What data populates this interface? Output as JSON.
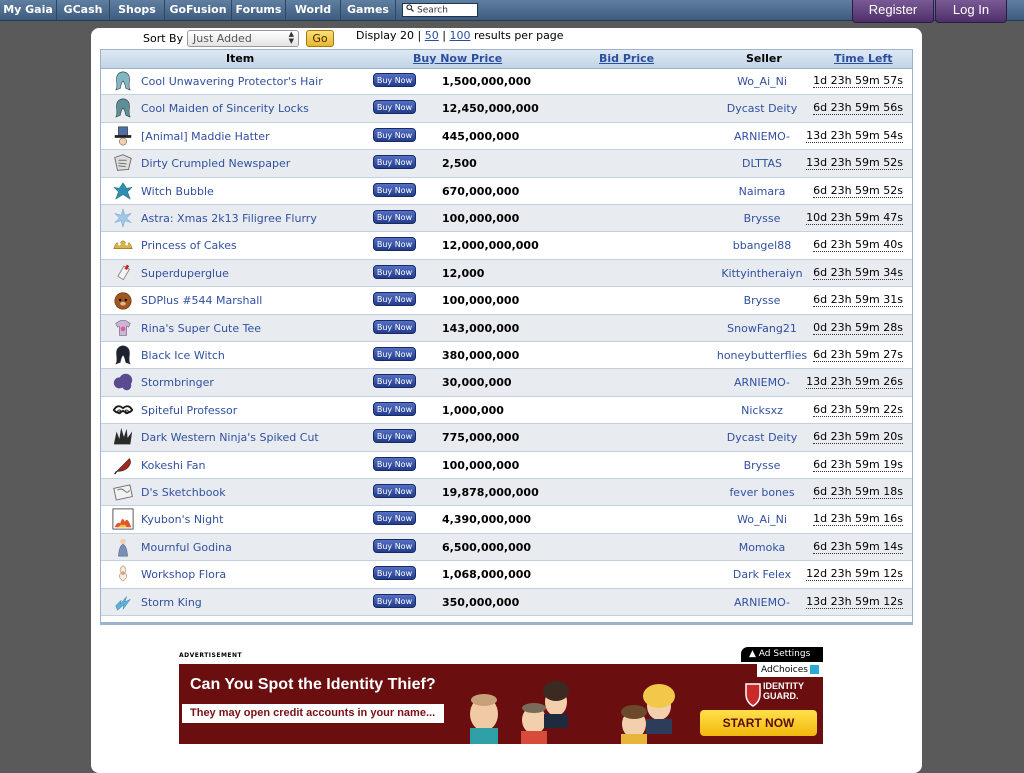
{
  "topnav": {
    "items": [
      "My Gaia",
      "GCash",
      "Shops",
      "GoFusion",
      "Forums",
      "World",
      "Games"
    ],
    "search_placeholder": "Search"
  },
  "auth": {
    "register": "Register",
    "login": "Log In"
  },
  "sort": {
    "label": "Sort By",
    "selected": "Just Added",
    "go": "Go",
    "display_prefix": "Display 20 |",
    "option_50": "50",
    "option_100": "100",
    "display_suffix": "results per page",
    "sep": "|"
  },
  "table": {
    "headers": {
      "item": "Item",
      "buy_now_price": "Buy Now Price",
      "bid_price": "Bid Price",
      "seller": "Seller",
      "time_left": "Time Left"
    },
    "buy_label": "Buy Now",
    "rows": [
      {
        "name": "Cool Unwavering Protector's Hair",
        "price": "1,500,000,000",
        "seller": "Wo_Ai_Ni",
        "time": "1d 23h 59m 57s",
        "icon": "hair-icon",
        "color": "#7fb8c4"
      },
      {
        "name": "Cool Maiden of Sincerity Locks",
        "price": "12,450,000,000",
        "seller": "Dycast Deity",
        "time": "6d 23h 59m 56s",
        "icon": "hair-icon",
        "color": "#5c8f97"
      },
      {
        "name": "[Animal] Maddie Hatter",
        "price": "445,000,000",
        "seller": "ARNIEMO-",
        "time": "13d 23h 59m 54s",
        "icon": "hat-icon",
        "color": "#4a6fa0"
      },
      {
        "name": "Dirty Crumpled Newspaper",
        "price": "2,500",
        "seller": "DLTTAS",
        "time": "13d 23h 59m 52s",
        "icon": "newspaper-icon",
        "color": "#6a6a6a"
      },
      {
        "name": "Witch Bubble",
        "price": "670,000,000",
        "seller": "Naimara",
        "time": "6d 23h 59m 52s",
        "icon": "bubble-icon",
        "color": "#2e8fb0"
      },
      {
        "name": "Astra: Xmas 2k13 Filigree Flurry",
        "price": "100,000,000",
        "seller": "Brysse",
        "time": "10d 23h 59m 47s",
        "icon": "snowflake-icon",
        "color": "#9fc7e8"
      },
      {
        "name": "Princess of Cakes",
        "price": "12,000,000,000",
        "seller": "bbangel88",
        "time": "6d 23h 59m 40s",
        "icon": "crown-icon",
        "color": "#d8b24a"
      },
      {
        "name": "Superduperglue",
        "price": "12,000",
        "seller": "Kittyintheraiyn",
        "time": "6d 23h 59m 34s",
        "icon": "glue-icon",
        "color": "#8a8a8a"
      },
      {
        "name": "SDPlus #544 Marshall",
        "price": "100,000,000",
        "seller": "Brysse",
        "time": "6d 23h 59m 31s",
        "icon": "plush-icon",
        "color": "#a0561f"
      },
      {
        "name": "Rina's Super Cute Tee",
        "price": "143,000,000",
        "seller": "SnowFang21",
        "time": "0d 23h 59m 28s",
        "icon": "shirt-icon",
        "color": "#c9b6d8"
      },
      {
        "name": "Black Ice Witch",
        "price": "380,000,000",
        "seller": "honeybutterflies",
        "time": "6d 23h 59m 27s",
        "icon": "hair-icon",
        "color": "#1d2230"
      },
      {
        "name": "Stormbringer",
        "price": "30,000,000",
        "seller": "ARNIEMO-",
        "time": "13d 23h 59m 26s",
        "icon": "cloud-icon",
        "color": "#5a4a8f"
      },
      {
        "name": "Spiteful Professor",
        "price": "1,000,000",
        "seller": "Nicksxz",
        "time": "6d 23h 59m 22s",
        "icon": "mustache-icon",
        "color": "#1a1a1a"
      },
      {
        "name": "Dark Western Ninja's Spiked Cut",
        "price": "775,000,000",
        "seller": "Dycast Deity",
        "time": "6d 23h 59m 20s",
        "icon": "spiky-hair-icon",
        "color": "#2a2a2a"
      },
      {
        "name": "Kokeshi Fan",
        "price": "100,000,000",
        "seller": "Brysse",
        "time": "6d 23h 59m 19s",
        "icon": "fan-icon",
        "color": "#a52420"
      },
      {
        "name": "D's Sketchbook",
        "price": "19,878,000,000",
        "seller": "fever bones",
        "time": "6d 23h 59m 18s",
        "icon": "sketchbook-icon",
        "color": "#6d6d6d"
      },
      {
        "name": "Kyubon's Night",
        "price": "4,390,000,000",
        "seller": "Wo_Ai_Ni",
        "time": "1d 23h 59m 16s",
        "icon": "fire-icon",
        "color": "#e0542a"
      },
      {
        "name": "Mournful Godina",
        "price": "6,500,000,000",
        "seller": "Momoka",
        "time": "6d 23h 59m 14s",
        "icon": "figure-icon",
        "color": "#7a8fb8"
      },
      {
        "name": "Workshop Flora",
        "price": "1,068,000,000",
        "seller": "Dark Felex",
        "time": "12d 23h 59m 12s",
        "icon": "flower-icon",
        "color": "#c9a48a"
      },
      {
        "name": "Storm King",
        "price": "350,000,000",
        "seller": "ARNIEMO-",
        "time": "13d 23h 59m 12s",
        "icon": "lightning-icon",
        "color": "#5fb0d8"
      }
    ]
  },
  "ad": {
    "label": "ADVERTISEMENT",
    "settings": "Ad Settings",
    "adchoices": "AdChoices",
    "headline": "Can You Spot the Identity Thief?",
    "subline": "They may open credit accounts in your name...",
    "brand_line1": "IDENTITY",
    "brand_line2": "GUARD.",
    "cta": "START NOW",
    "bg_color": "#6b0e10",
    "cta_color": "#f5c418"
  }
}
